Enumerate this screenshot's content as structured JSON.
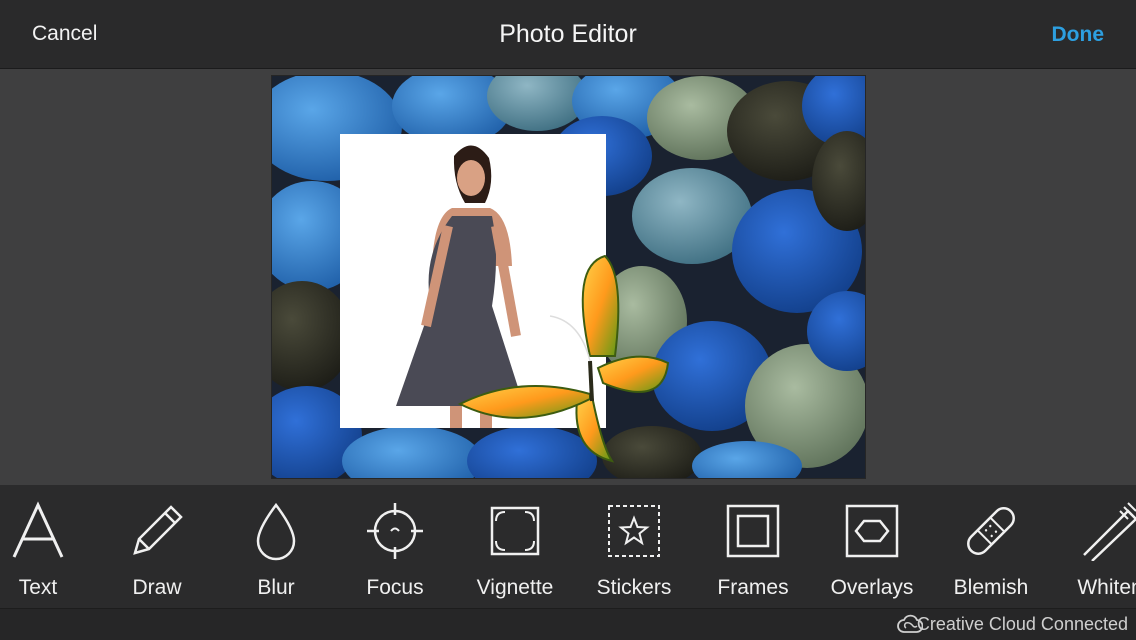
{
  "header": {
    "cancel_label": "Cancel",
    "title": "Photo Editor",
    "done_label": "Done",
    "accent_color": "#2d9fe0"
  },
  "canvas": {
    "image_description_icon": "edited-photo"
  },
  "tools": [
    {
      "label": "Text",
      "icon": "text-icon"
    },
    {
      "label": "Draw",
      "icon": "pencil-icon"
    },
    {
      "label": "Blur",
      "icon": "drop-icon"
    },
    {
      "label": "Focus",
      "icon": "crosshair-icon"
    },
    {
      "label": "Vignette",
      "icon": "vignette-icon"
    },
    {
      "label": "Stickers",
      "icon": "sticker-star-icon"
    },
    {
      "label": "Frames",
      "icon": "frame-icon"
    },
    {
      "label": "Overlays",
      "icon": "hexagon-overlay-icon"
    },
    {
      "label": "Blemish",
      "icon": "bandage-icon"
    },
    {
      "label": "Whiten",
      "icon": "toothbrush-icon"
    }
  ],
  "footer": {
    "status_text": "Creative Cloud Connected",
    "icon": "creative-cloud-icon"
  }
}
